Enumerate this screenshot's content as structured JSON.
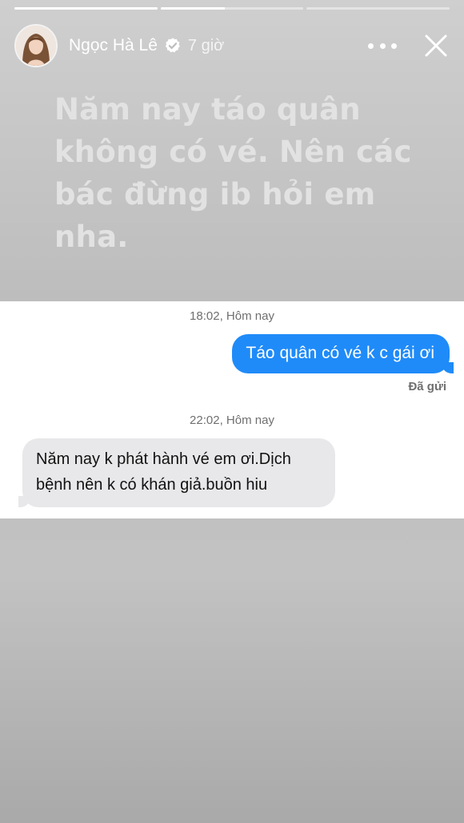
{
  "story": {
    "progress": [
      1.0,
      0.45,
      0.0
    ],
    "user": {
      "name": "Ngọc Hà Lê",
      "verified": true,
      "time_ago": "7 giờ"
    },
    "icons": {
      "avatar": "avatar",
      "verified": "verified-badge-icon",
      "more": "more-options-icon",
      "close": "close-icon"
    },
    "caption": "Năm nay táo quân không có vé. Nên các bác đừng ib hỏi em nha.",
    "colors": {
      "outgoing_bubble": "#1f8bf8",
      "incoming_bubble": "#e8e8ea",
      "caption_text": "#e2e2e2"
    }
  },
  "messages": {
    "stamp_1": "18:02, Hôm nay",
    "outgoing": "Táo quân có vé k c gái ơi",
    "delivered": "Đã gửi",
    "stamp_2": "22:02, Hôm nay",
    "incoming": "Năm nay k phát hành vé em ơi.Dịch bệnh nên k có khán giả.buồn hiu"
  }
}
